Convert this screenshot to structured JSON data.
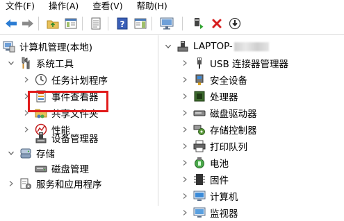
{
  "menu": [
    "文件(F)",
    "操作(A)",
    "查看(V)",
    "帮助(H)"
  ],
  "toolbar_icons": [
    "back-arrow-icon",
    "forward-arrow-icon",
    "up-folder-icon",
    "show-hide-tree-icon",
    "properties-icon",
    "help-icon",
    "action-pane-icon",
    "monitor-icon",
    "update-driver-icon",
    "uninstall-icon",
    "scan-hardware-icon"
  ],
  "left_tree": {
    "root": "计算机管理(本地)",
    "system_tools": "系统工具",
    "task_scheduler": "任务计划程序",
    "event_viewer": "事件查看器",
    "shared_folders": "共享文件夹",
    "performance": "性能",
    "device_manager": "设备管理器",
    "storage": "存储",
    "disk_management": "磁盘管理",
    "services_apps": "服务和应用程序"
  },
  "right_tree": {
    "computer_name": "LAPTOP-",
    "items": [
      {
        "label": "USB 连接器管理器",
        "icon": "usb-connector-icon"
      },
      {
        "label": "安全设备",
        "icon": "security-device-icon"
      },
      {
        "label": "处理器",
        "icon": "processor-icon"
      },
      {
        "label": "磁盘驱动器",
        "icon": "disk-drive-icon"
      },
      {
        "label": "存储控制器",
        "icon": "storage-controller-icon"
      },
      {
        "label": "打印队列",
        "icon": "print-queue-icon"
      },
      {
        "label": "电池",
        "icon": "battery-icon"
      },
      {
        "label": "固件",
        "icon": "firmware-icon"
      },
      {
        "label": "计算机",
        "icon": "computer-icon"
      },
      {
        "label": "监视器",
        "icon": "monitor-icon"
      }
    ]
  },
  "colors": {
    "highlight": "#e11b1b",
    "accent": "#2b7cd3"
  }
}
